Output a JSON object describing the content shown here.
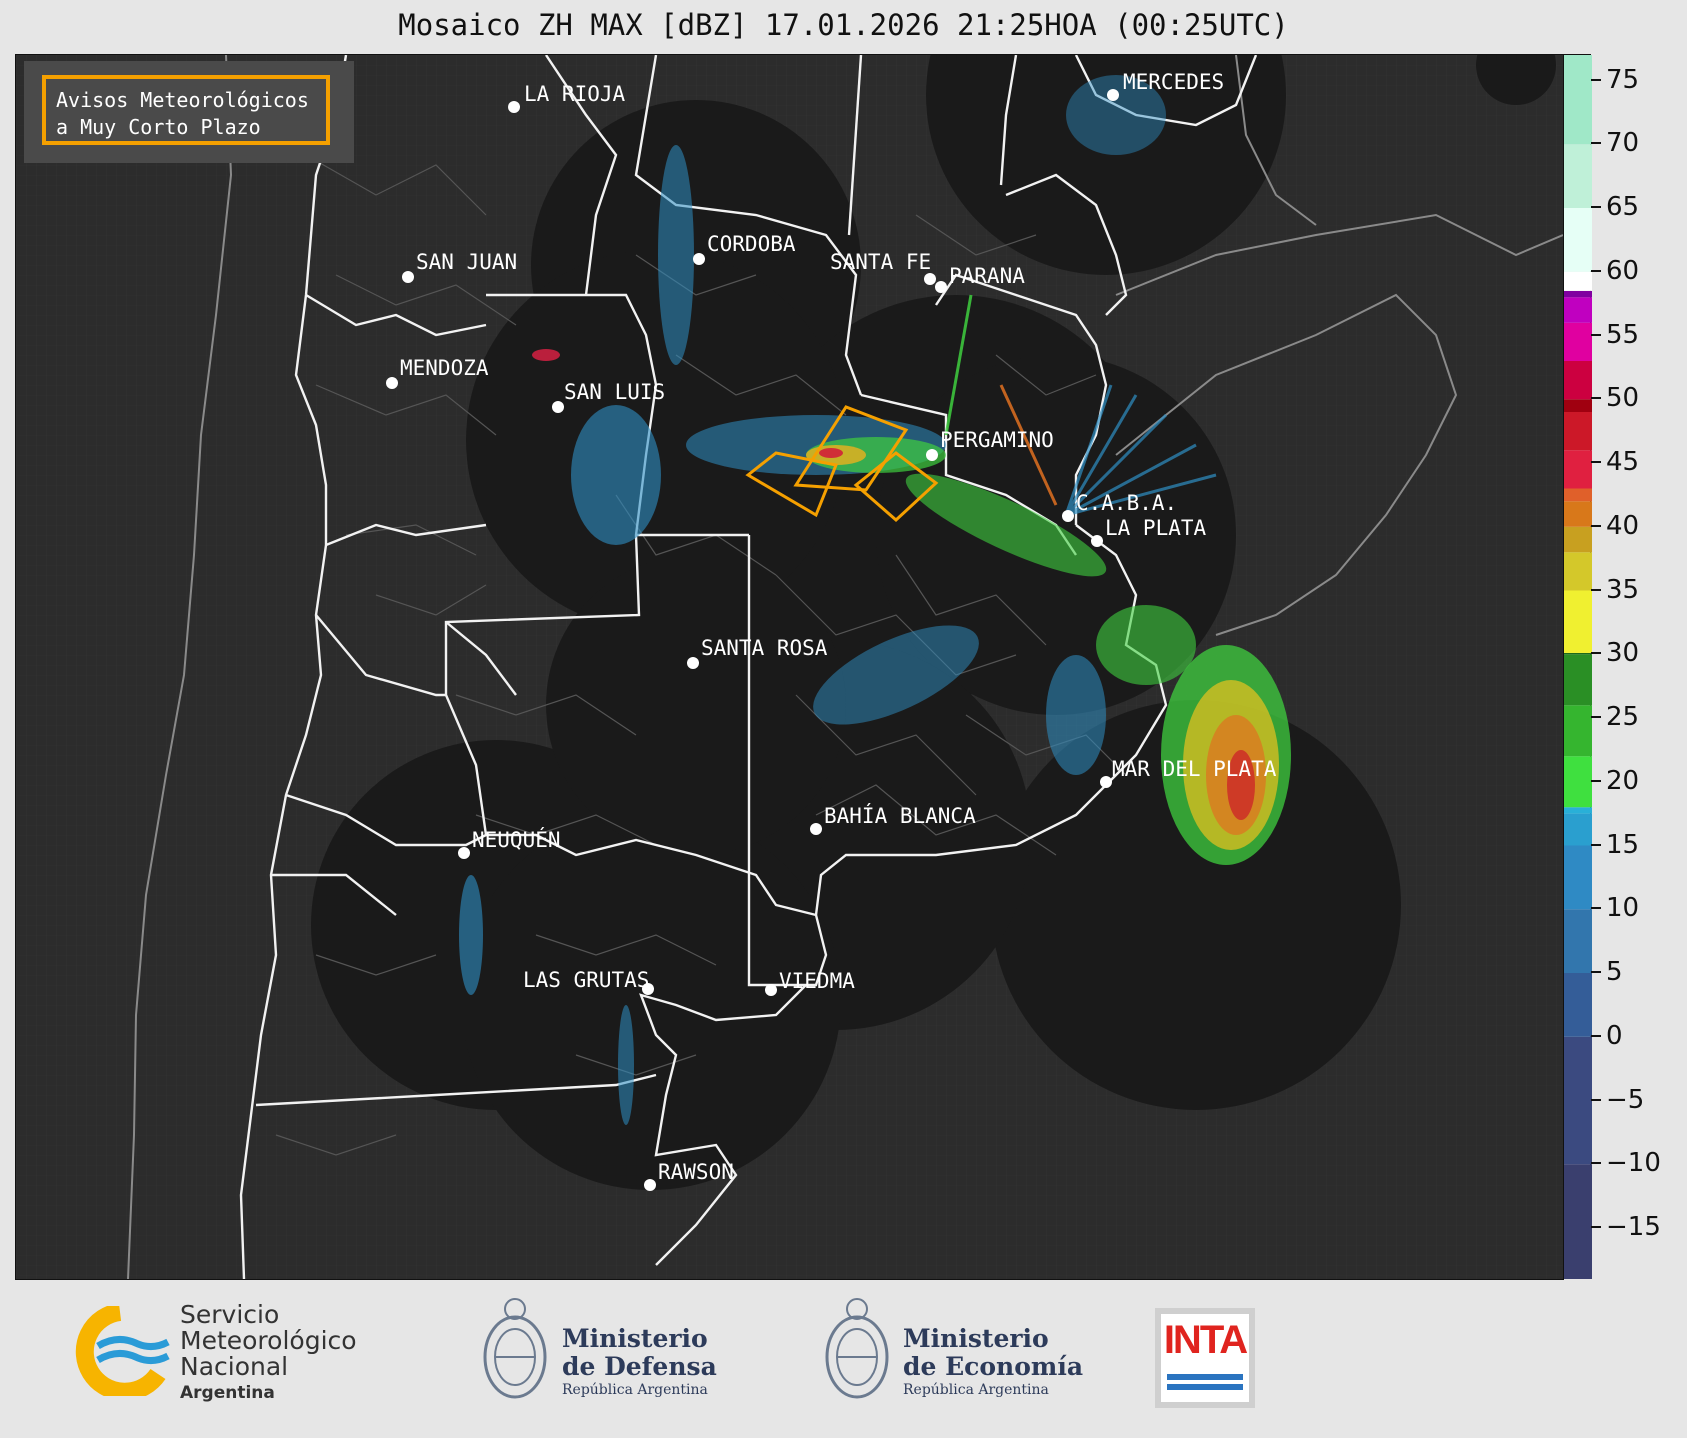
{
  "title": "Mosaico ZH MAX [dBZ] 17.01.2026 21:25HOA (00:25UTC)",
  "legend": {
    "line1": "Avisos Meteorológicos",
    "line2": "a Muy Corto Plazo",
    "border_color": "#f5a000"
  },
  "cities": [
    {
      "name": "LA RIOJA"
    },
    {
      "name": "MERCEDES"
    },
    {
      "name": "SAN JUAN"
    },
    {
      "name": "CORDOBA"
    },
    {
      "name": "SANTA FE"
    },
    {
      "name": "PARANA"
    },
    {
      "name": "MENDOZA"
    },
    {
      "name": "SAN LUIS"
    },
    {
      "name": "PERGAMINO"
    },
    {
      "name": "C.A.B.A."
    },
    {
      "name": "LA PLATA"
    },
    {
      "name": "SANTA ROSA"
    },
    {
      "name": "MAR DEL PLATA"
    },
    {
      "name": "BAHÍA BLANCA"
    },
    {
      "name": "NEUQUÉN"
    },
    {
      "name": "LAS GRUTAS"
    },
    {
      "name": "VIEDMA"
    },
    {
      "name": "RAWSON"
    }
  ],
  "colorbar": {
    "unit": "dBZ",
    "ticks": [
      "75",
      "70",
      "65",
      "60",
      "55",
      "50",
      "45",
      "40",
      "35",
      "30",
      "25",
      "20",
      "15",
      "10",
      "5",
      "0",
      "−5",
      "−10",
      "−15"
    ],
    "range": [
      -19,
      77
    ]
  },
  "footer": {
    "smn": {
      "line1": "Servicio",
      "line2": "Meteorológico",
      "line3": "Nacional",
      "line4": "Argentina"
    },
    "defensa": {
      "line1": "Ministerio",
      "line2": "de Defensa",
      "line3": "República Argentina"
    },
    "economia": {
      "line1": "Ministerio",
      "line2": "de Economía",
      "line3": "República Argentina"
    },
    "inta": {
      "label": "INTA"
    }
  },
  "colors": {
    "background": "#e6e6e6",
    "map_background": "#2c2c2c",
    "radar_coverage": "#1a1a1a",
    "warning_polygon": "#f5a000"
  }
}
